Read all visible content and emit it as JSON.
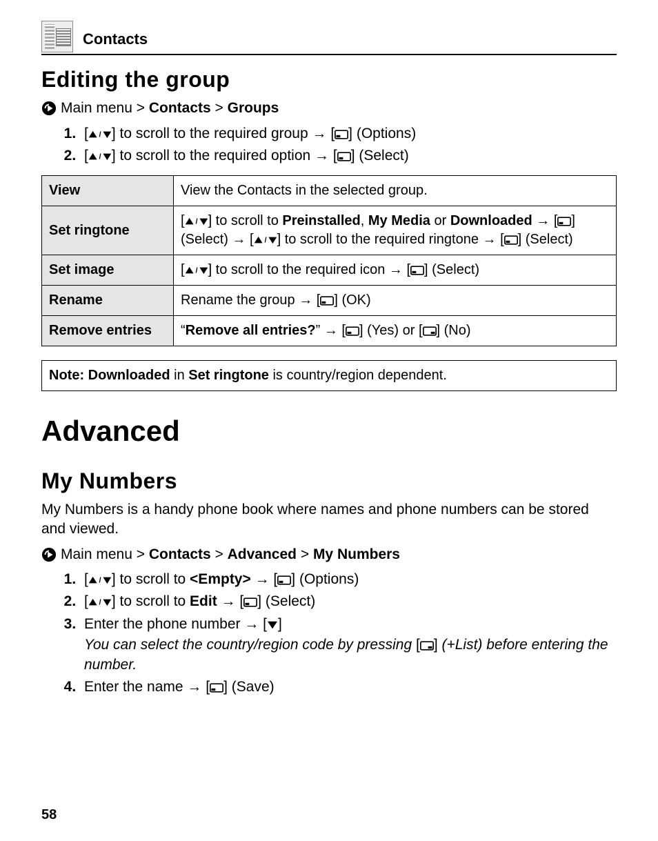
{
  "header": {
    "section": "Contacts"
  },
  "editing": {
    "title": "Editing the group",
    "nav_prefix": "Main menu",
    "nav_item1": "Contacts",
    "nav_item2": "Groups",
    "step1_pre": "[",
    "step1_mid": "] to scroll to the required group → [",
    "step1_post": "] (Options)",
    "step2_pre": "[",
    "step2_mid": "] to scroll to the required option → [",
    "step2_post": "] (Select)"
  },
  "table": {
    "view": {
      "label": "View",
      "desc": "View the Contacts in the selected group."
    },
    "set_ringtone": {
      "label": "Set ringtone",
      "p1_pre": "[",
      "p1_mid1": "] to scroll to ",
      "p1_b1": "Preinstalled",
      "p1_sep1": ", ",
      "p1_b2": "My Media",
      "p1_or": " or ",
      "p1_b3": "Downloaded",
      "p1_arr1": " → [",
      "p1_sel1": "] (Select) → [",
      "p1_mid2": "] to scroll to the required ringtone → [",
      "p1_sel2": "] (Select)"
    },
    "set_image": {
      "label": "Set image",
      "pre": "[",
      "mid": "] to scroll to the required icon → [",
      "post": "] (Select)"
    },
    "rename": {
      "label": "Rename",
      "pre": "Rename the group → [",
      "post": "] (OK)"
    },
    "remove": {
      "label": "Remove entries",
      "pre": "“",
      "bold": "Remove all entries?",
      "mid1": "” → [",
      "mid2": "] (Yes) or [",
      "post": "] (No)"
    }
  },
  "note": {
    "pre": "Note: ",
    "b1": "Downloaded",
    "mid": " in ",
    "b2": "Set ringtone",
    "post": " is country/region dependent."
  },
  "advanced": {
    "title": "Advanced",
    "my_numbers_title": "My Numbers",
    "my_numbers_desc": "My Numbers is a handy phone book where names and phone numbers can be stored and viewed.",
    "nav_prefix": "Main menu",
    "nav_item1": "Contacts",
    "nav_item2": "Advanced",
    "nav_item3": "My Numbers",
    "step1_pre": "[",
    "step1_mid": "] to scroll to ",
    "step1_b": "<Empty>",
    "step1_arr": " → [",
    "step1_post": "] (Options)",
    "step2_pre": "[",
    "step2_mid": "] to scroll to ",
    "step2_b": "Edit",
    "step2_arr": " → [",
    "step2_post": "] (Select)",
    "step3_pre": "Enter the phone number → [",
    "step3_post": "]",
    "step3_note_pre": "You can select the country/region code by pressing ",
    "step3_note_mid1": "[",
    "step3_note_mid2": "]",
    "step3_note_post": " (+List) before entering the number.",
    "step4_pre": "Enter the name → [",
    "step4_post": "] (Save)"
  },
  "page_number": "58"
}
